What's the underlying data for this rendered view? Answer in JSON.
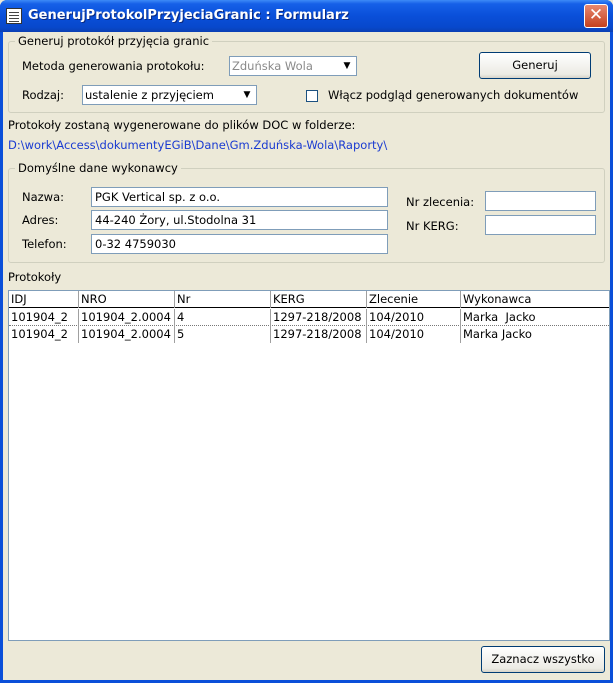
{
  "window": {
    "title": "GenerujProtokolPrzyjeciaGranic : Formularz",
    "close_glyph": "✕"
  },
  "generate_group": {
    "legend": "Generuj protokół przyjęcia granic",
    "method_label": "Metoda generowania protokołu:",
    "method_value": "Zduńska Wola",
    "type_label": "Rodzaj:",
    "type_value": "ustalenie z przyjęciem",
    "generate_button": "Generuj",
    "preview_checkbox_label": "Włącz podgląd generowanych dokumentów",
    "preview_checked": false
  },
  "output_info": {
    "text": "Protokoły zostaną wygenerowane do plików DOC w folderze:",
    "path": "D:\\work\\Access\\dokumentyEGiB\\Dane\\Gm.Zduńska-Wola\\Raporty\\"
  },
  "contractor_group": {
    "legend": "Domyślne dane wykonawcy",
    "name_label": "Nazwa:",
    "name_value": "PGK Vertical sp. z o.o.",
    "address_label": "Adres:",
    "address_value": "44-240 Żory, ul.Stodolna 31",
    "phone_label": "Telefon:",
    "phone_value": "0-32 4759030",
    "order_label": "Nr zlecenia:",
    "order_value": "",
    "kerg_label": "Nr KERG:",
    "kerg_value": ""
  },
  "protocols": {
    "label": "Protokoły",
    "columns": [
      "IDJ",
      "NRO",
      "Nr",
      "KERG",
      "Zlecenie",
      "Wykonawca"
    ],
    "rows": [
      [
        "101904_2",
        "101904_2.0004",
        "4",
        "1297-218/2008",
        "104/2010",
        "Marka  Jacko"
      ],
      [
        "101904_2",
        "101904_2.0004",
        "5",
        "1297-218/2008",
        "104/2010",
        "Marka Jacko"
      ]
    ]
  },
  "select_all_button": "Zaznacz wszystko",
  "colors": {
    "titlebar": "#0a4fd9",
    "form_background": "#ece9d8",
    "link_text": "#1a3bd1"
  }
}
